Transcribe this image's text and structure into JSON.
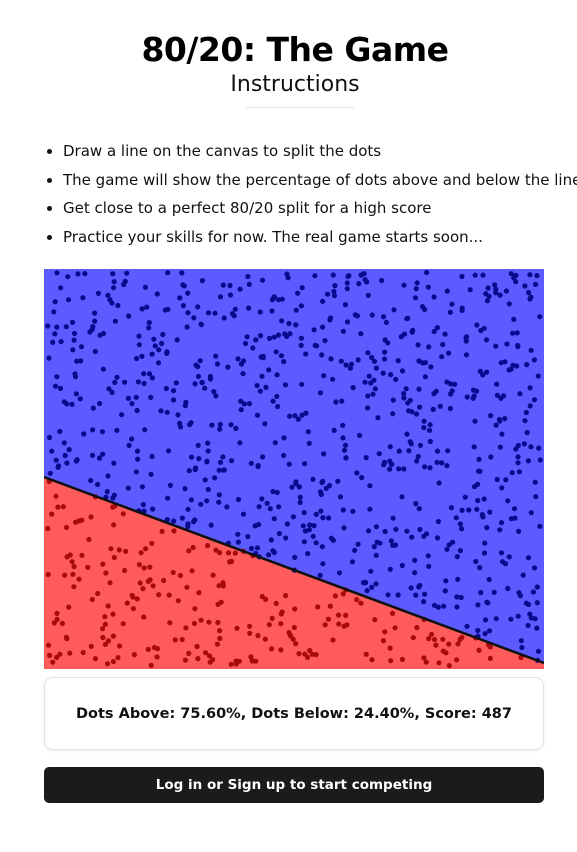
{
  "header": {
    "title": "80/20: The Game",
    "subtitle": "Instructions"
  },
  "instructions": [
    "Draw a line on the canvas to split the dots",
    "The game will show the percentage of dots above and below the line",
    "Get close to a perfect 80/20 split for a high score",
    "Practice your skills for now. The real game starts soon..."
  ],
  "game": {
    "colors": {
      "above_region": "#5b5bff",
      "below_region": "#ff5b5b",
      "above_dot": "#0a0a8e",
      "below_dot": "#a80b0b",
      "line": "#111111"
    },
    "result_text": "Dots Above: 75.60%, Dots Below: 24.40%, Score: 487",
    "above_percent": 75.6,
    "below_percent": 24.4,
    "score": 487
  },
  "cta": {
    "label": "Log in or Sign up to start competing"
  }
}
